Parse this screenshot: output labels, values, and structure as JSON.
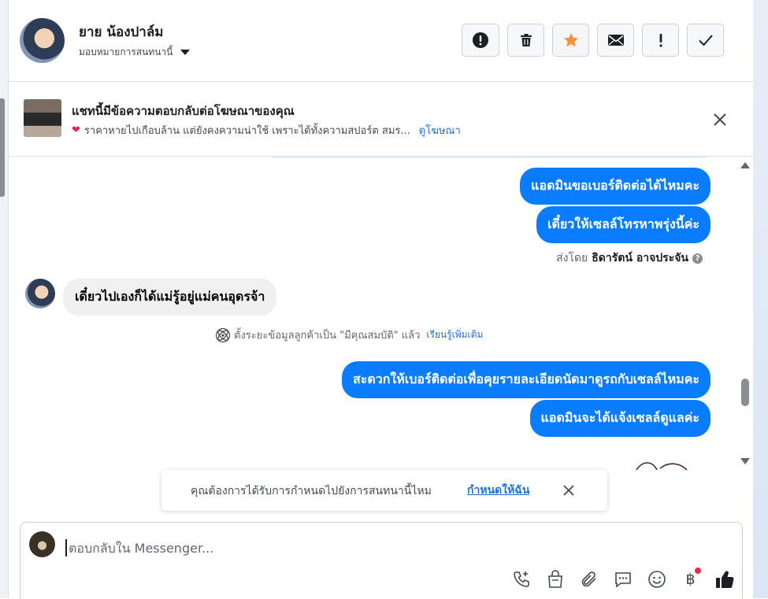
{
  "header": {
    "contact_name": "ยาย น้องปาล์ม",
    "assign_label": "มอบหมายการสนทนานี้",
    "buttons": [
      {
        "name": "mark-spam",
        "icon": "alert-octagon-icon"
      },
      {
        "name": "delete",
        "icon": "trash-icon"
      },
      {
        "name": "star",
        "icon": "star-icon",
        "color": "#f7923a"
      },
      {
        "name": "mark-unread",
        "icon": "envelope-icon"
      },
      {
        "name": "follow-up",
        "icon": "exclamation-icon"
      },
      {
        "name": "mark-done",
        "icon": "checkmark-icon"
      }
    ]
  },
  "ad_banner": {
    "title": "แชทนี้มีข้อความตอบกลับต่อโฆษณาของคุณ",
    "snippet": "ราคาหายไปเกือบล้าน แต่ยังคงความน่าใช้ เพราะได้ทั้งความสปอร์ต สมร...",
    "link": "ดูโฆษณา"
  },
  "messages": {
    "out_1": "แอดมินขอเบอร์ติดต่อได้ไหมคะ",
    "out_2": "เดี๋ยวให้เซลล์โทรหาพรุ่งนี้ค่ะ",
    "sent_by_prefix": "ส่งโดย",
    "sent_by_name": "ธิดารัตน์ อาจประจัน",
    "in_1": "เดี๋ยวไปเองก็ได้แม่รู้อยู่แม่คนอุดรจ้า",
    "system_text": "ตั้งระยะข้อมูลลูกค้าเป็น \"มีคุณสมบัติ\" แล้ว",
    "system_link": "เรียนรู้เพิ่มเติม",
    "out_3": "สะดวกให้เบอร์ติดต่อเพื่อคุยรายละเอียดนัดมาดูรถกับเซลล์ไหมคะ",
    "out_4": "แอดมินจะได้แจ้งเซลล์ดูแลค่ะ"
  },
  "toast": {
    "text": "คุณต้องการได้รับการกำหนดไปยังการสนทนานี้ไหม",
    "link": "กำหนดให้ฉัน"
  },
  "composer": {
    "placeholder": "ตอบกลับใน Messenger...",
    "tools": [
      "phone-plus-icon",
      "shopping-bag-icon",
      "paperclip-icon",
      "chat-bubble-icon",
      "smiley-icon",
      "baht-icon",
      "thumbs-up-icon"
    ],
    "baht_symbol": "฿"
  },
  "colors": {
    "outgoing_bubble": "#0a7cff",
    "incoming_bubble": "#f0f0f0",
    "link": "#216fdb",
    "star": "#f7923a"
  }
}
